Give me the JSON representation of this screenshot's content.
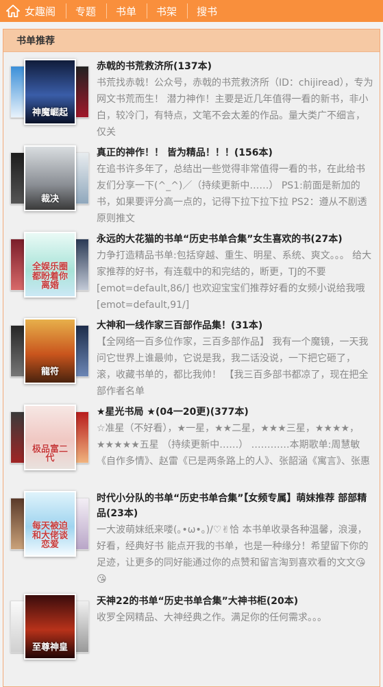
{
  "nav": {
    "site": "女趣阁",
    "items": [
      "专题",
      "书单",
      "书架",
      "搜书"
    ]
  },
  "colors": {
    "nav_bg": "#f98f3c",
    "panel_header_bg": "#f6c9a4"
  },
  "panel": {
    "title": "书单推荐"
  },
  "booklists": [
    {
      "title": "赤戟的书荒救济所(137本)",
      "desc": "书荒找赤戟！公众号，赤戟的书荒救济所（ID：chijiread），专为网文书荒而生！ 潜力神作！主要是近几年值得一看的新书，非小白，较冷门，有特点，文笔不会太差的作品。量大类广不细言，仅关",
      "cover_text": "神魔崛起"
    },
    {
      "title": "真正的神作！！ 皆为精品！！！(156本)",
      "desc": "在追书许多年了，总结出一些觉得非常值得一看的书，在此给书友们分享一下(^_^)／（持续更新中……） PS1:前面是新加的书，如果要评分高一点的，记得下拉下拉下拉 PS2：遵从不剧透原则推文",
      "cover_text": "裁决"
    },
    {
      "title": "永远的大花猫的书单“历史书单合集”女生喜欢的书(27本)",
      "desc": "力争打造精品书单:包括穿越、重生、明星、系统、爽文。。。 给大家推荐的好书，有连载中的和完结的，断更，TJ的不要[emot=default,86/] 也欢迎宝宝们推荐好看的女频小说给我哦[emot=default,91/]",
      "cover_text": "全娱乐圈都盼着你离婚"
    },
    {
      "title": "大神和一线作家三百部作品集！(31本)",
      "desc": "【全网络一百多位作家，三百多部作品】 我有一个魔镜，一天我问它世界上谁最帅，它说是我，我二话没说，一下把它砸了，滚，收藏书单的，都比我帅！ 【我三百多部书都凉了，现在把全部作者名单",
      "cover_text": "龍符"
    },
    {
      "title": "★星光书局 ★(04一20更)(377本)",
      "desc": "☆准星（不好看），★一星，★★二星，★★★三星，★★★★，★★★★★五星 （持续更新中……） …………本期歌单:周慧敏《自作多情》、赵雷《已是两条路上的人》、张韶涵《寓言》、张惠",
      "cover_text": "极品富二代"
    },
    {
      "title": "时代小分队的书单“历史书单合集”【女频专属】萌妹推荐 部部精品(23本)",
      "desc": "一大波萌妹纸来喽(｡•ω•｡)/♡✌恰 本书单收录各种温馨，浪漫，好看，经典好书 能点开我的书单，也是一种缘分！希望留下你的足迹，让更多的同好能通过你的点赞和留言淘到喜欢看的文文😘😘",
      "cover_text": "每天被迫和大佬谈恋爱"
    },
    {
      "title": "天神22的书单“历史书单合集”大神书柜(20本)",
      "desc": "收罗全网精品、大神经典之作。满足你的任何需求。。。",
      "cover_text": "至尊神皇"
    }
  ]
}
